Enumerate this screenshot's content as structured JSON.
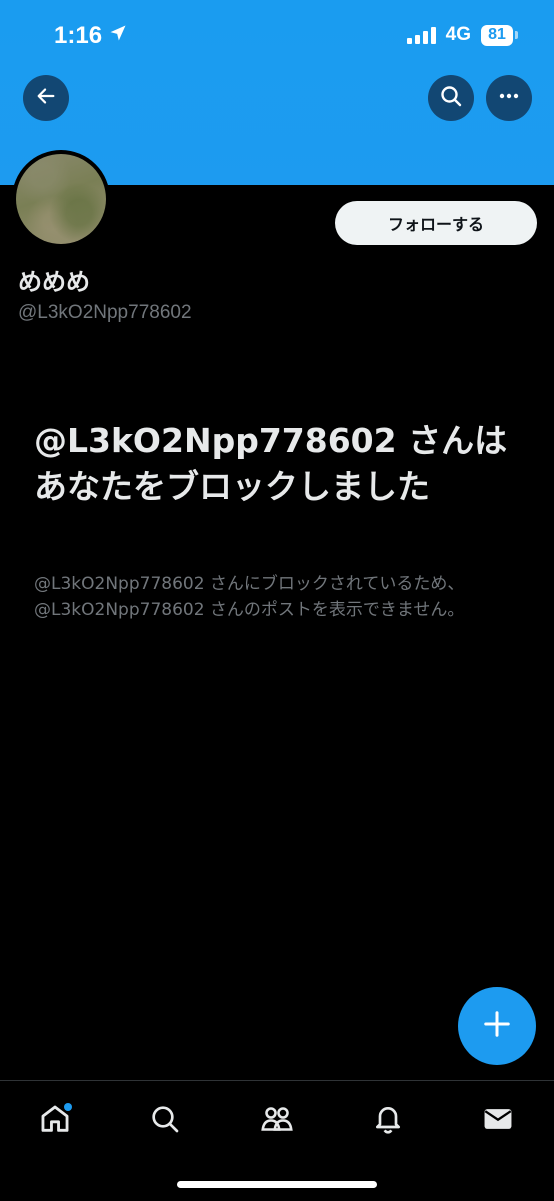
{
  "status_bar": {
    "time": "1:16",
    "network": "4G",
    "battery": "81"
  },
  "header": {
    "back_icon": "arrow-left-icon",
    "search_icon": "search-icon",
    "more_icon": "ellipsis-icon"
  },
  "profile": {
    "display_name": "めめめ",
    "handle": "@L3kO2Npp778602",
    "follow_label": "フォローする"
  },
  "blocked": {
    "title": "@L3kO2Npp778602 さんはあなたをブロックしました",
    "description": "@L3kO2Npp778602 さんにブロックされているため、@L3kO2Npp778602 さんのポストを表示できません。"
  },
  "compose": {
    "icon": "plus-icon"
  },
  "tabbar": {
    "items": [
      {
        "name": "home",
        "icon": "home-icon",
        "has_notification_dot": true
      },
      {
        "name": "search",
        "icon": "search-icon"
      },
      {
        "name": "communities",
        "icon": "people-icon"
      },
      {
        "name": "notifications",
        "icon": "bell-icon"
      },
      {
        "name": "messages",
        "icon": "envelope-icon"
      }
    ]
  },
  "colors": {
    "accent": "#1d9bf0",
    "background": "#000000",
    "text_primary": "#e7e9ea",
    "text_secondary": "#71767b"
  }
}
